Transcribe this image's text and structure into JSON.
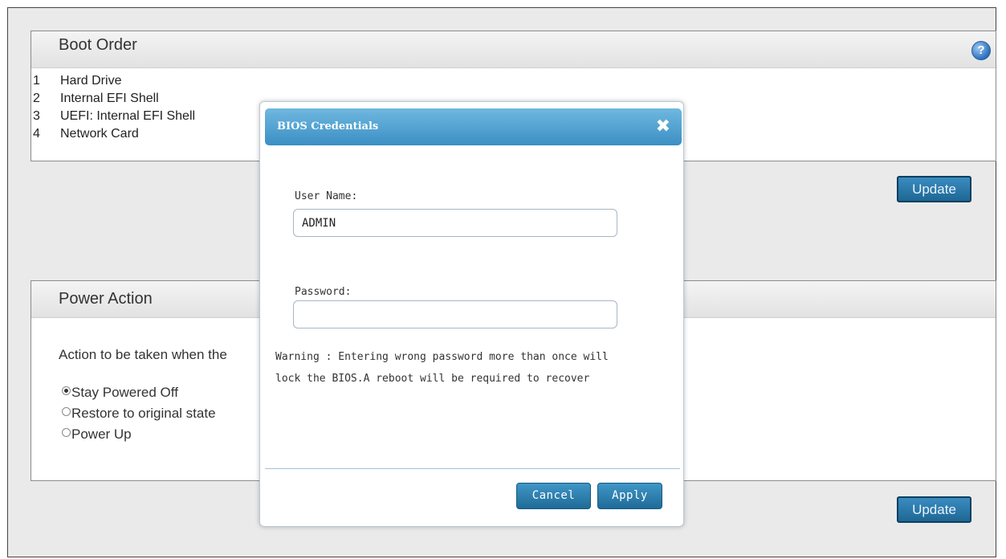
{
  "boot_order": {
    "title": "Boot Order",
    "help_icon": "question-mark-icon",
    "items": [
      {
        "num": "1",
        "name": "Hard Drive"
      },
      {
        "num": "2",
        "name": "Internal EFI Shell"
      },
      {
        "num": "3",
        "name": "UEFI: Internal EFI Shell"
      },
      {
        "num": "4",
        "name": "Network Card"
      }
    ],
    "update_label": "Update"
  },
  "power_action": {
    "title": "Power Action",
    "description": "Action to be taken when the",
    "options": [
      {
        "label": "Stay Powered Off",
        "selected": true
      },
      {
        "label": "Restore to original state",
        "selected": false
      },
      {
        "label": "Power Up",
        "selected": false
      }
    ],
    "update_label": "Update"
  },
  "dialog": {
    "title": "BIOS Credentials",
    "close_glyph": "✖",
    "username_label": "User Name:",
    "username_value": "ADMIN",
    "password_label": "Password:",
    "password_value": "",
    "warning_line1": "Warning : Entering wrong password more than once will",
    "warning_line2": "lock the BIOS.A reboot will be required to recover",
    "cancel_label": "Cancel",
    "apply_label": "Apply"
  },
  "colors": {
    "accent": "#3b8fc4",
    "button": "#1e6794",
    "background": "#eaeaea"
  }
}
